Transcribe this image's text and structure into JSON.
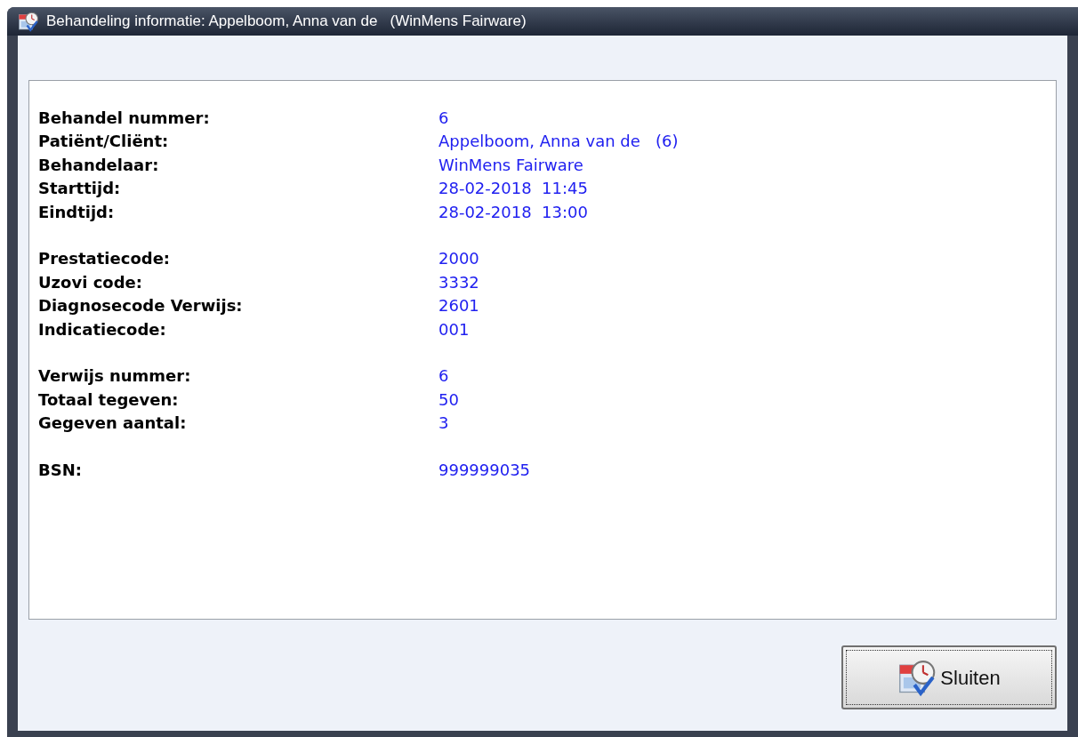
{
  "window": {
    "title": "Behandeling informatie: Appelboom, Anna van de   (WinMens Fairware)"
  },
  "groups": [
    [
      {
        "label": "Behandel nummer:",
        "value": "6"
      },
      {
        "label": "Patiënt/Cliënt:",
        "value": "Appelboom, Anna van de   (6)"
      },
      {
        "label": "Behandelaar:",
        "value": "WinMens Fairware"
      },
      {
        "label": "Starttijd:",
        "value": "28-02-2018  11:45"
      },
      {
        "label": "Eindtijd:",
        "value": "28-02-2018  13:00"
      }
    ],
    [
      {
        "label": "Prestatiecode:",
        "value": "2000"
      },
      {
        "label": "Uzovi code:",
        "value": "3332"
      },
      {
        "label": "Diagnosecode Verwijs:",
        "value": "2601"
      },
      {
        "label": "Indicatiecode:",
        "value": "001"
      }
    ],
    [
      {
        "label": "Verwijs nummer:",
        "value": "6"
      },
      {
        "label": "Totaal tegeven:",
        "value": "50"
      },
      {
        "label": "Gegeven aantal:",
        "value": "3"
      }
    ],
    [
      {
        "label": "BSN:",
        "value": "999999035"
      }
    ]
  ],
  "close_button": {
    "label": "Sluiten"
  }
}
